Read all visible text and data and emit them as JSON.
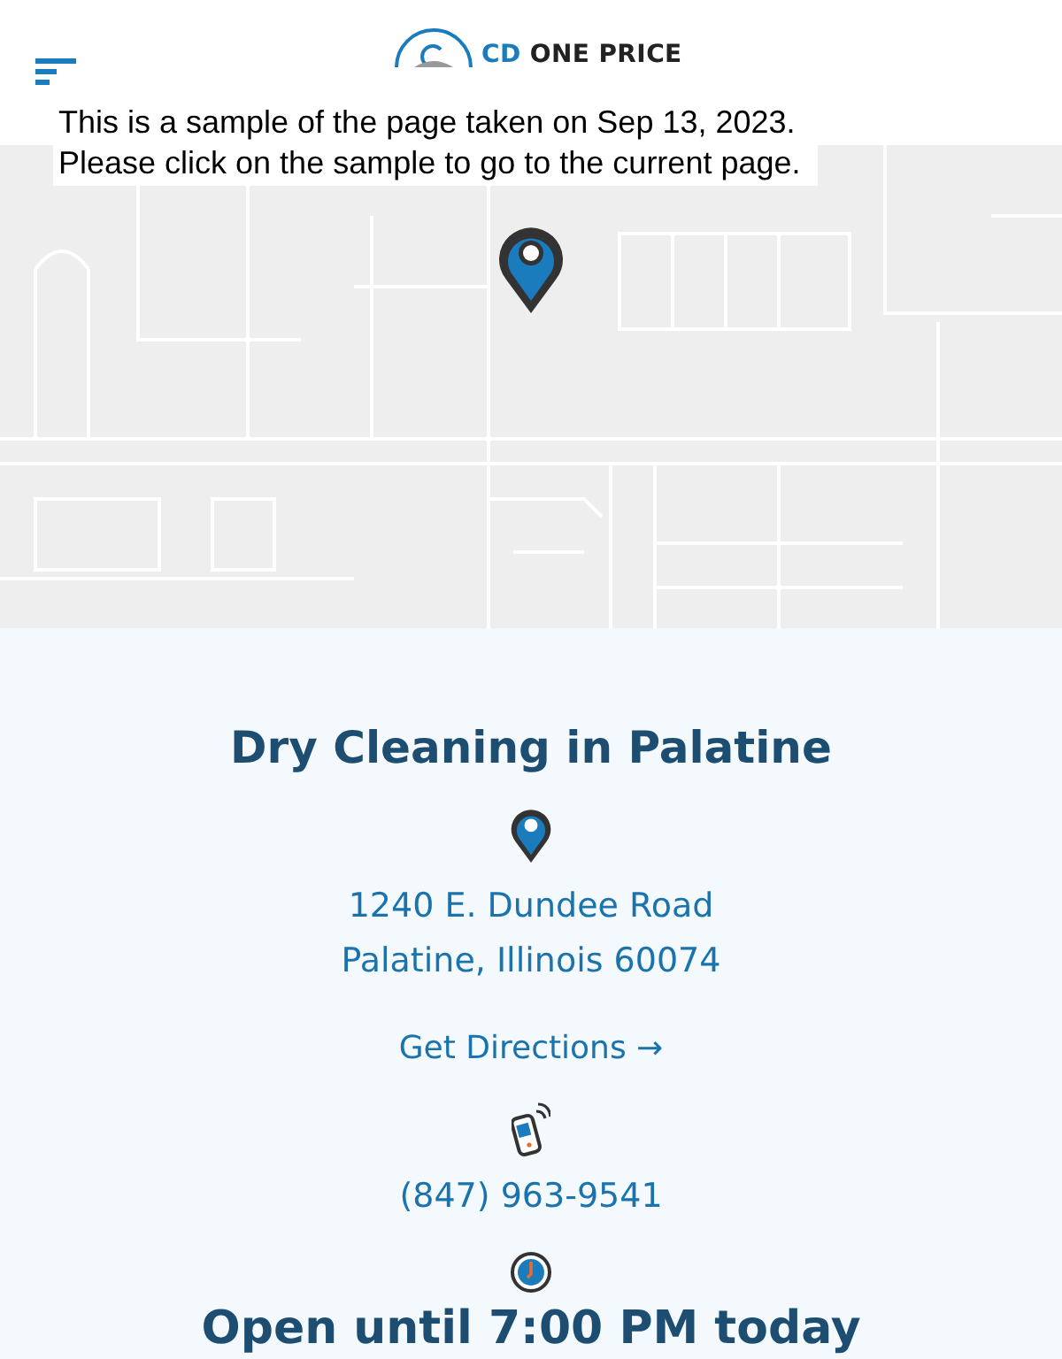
{
  "header": {
    "logo": {
      "prefix": "CD",
      "name": "ONE PRICE"
    }
  },
  "notice": [
    "This is a sample of the page taken on Sep 13, 2023.",
    "Please click on the sample to go to the current page."
  ],
  "location": {
    "title": "Dry Cleaning in Palatine",
    "address": [
      "1240 E. Dundee Road",
      "Palatine, Illinois 60074"
    ],
    "directions": "Get Directions",
    "directions_arrow": "→",
    "phone": "(847) 963-9541",
    "hours": "Open until 7:00 PM today"
  }
}
